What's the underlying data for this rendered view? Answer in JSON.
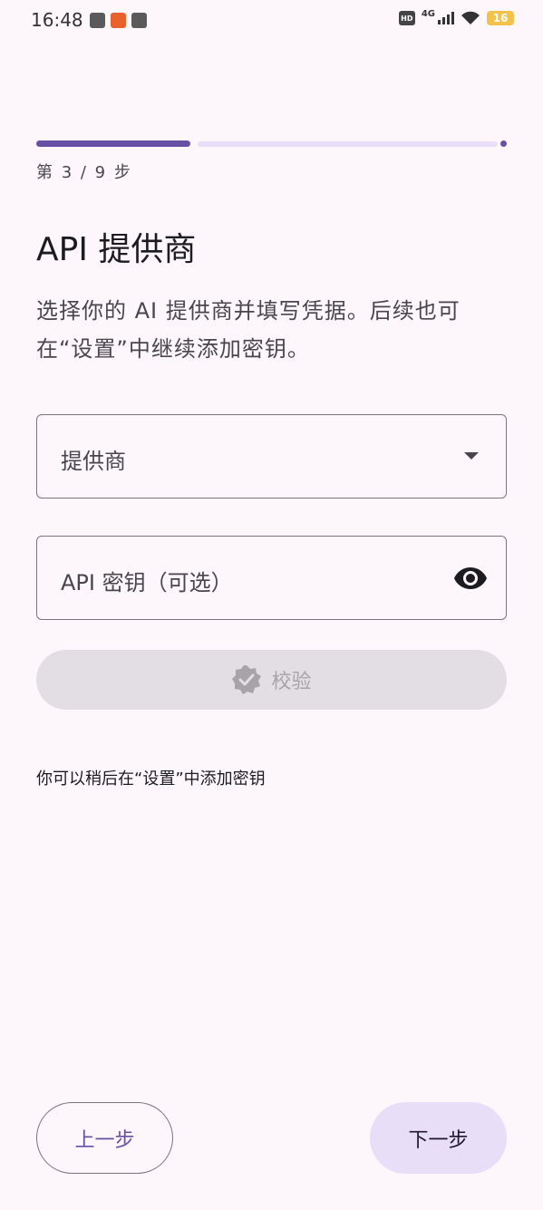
{
  "status_bar": {
    "time": "16:48",
    "hd_label": "HD",
    "network_type": "4G",
    "battery_level": "16",
    "battery_color": "#F3C24A"
  },
  "progress": {
    "current_step": 3,
    "total_steps": 9,
    "label": "第 3 / 9 步",
    "accent_color": "#6750A4"
  },
  "page": {
    "title": "API 提供商",
    "description": "选择你的 AI 提供商并填写凭据。后续也可在“设置”中继续添加密钥。"
  },
  "form": {
    "provider_field": {
      "label": "提供商",
      "icon": "dropdown-arrow-icon"
    },
    "api_key_field": {
      "label": "API 密钥（可选）",
      "icon": "eye-icon"
    },
    "verify_button": {
      "label": "校验",
      "icon": "verified-badge-icon",
      "disabled": true
    }
  },
  "hint": "你可以稍后在“设置”中添加密钥",
  "footer": {
    "back_label": "上一步",
    "next_label": "下一步"
  }
}
